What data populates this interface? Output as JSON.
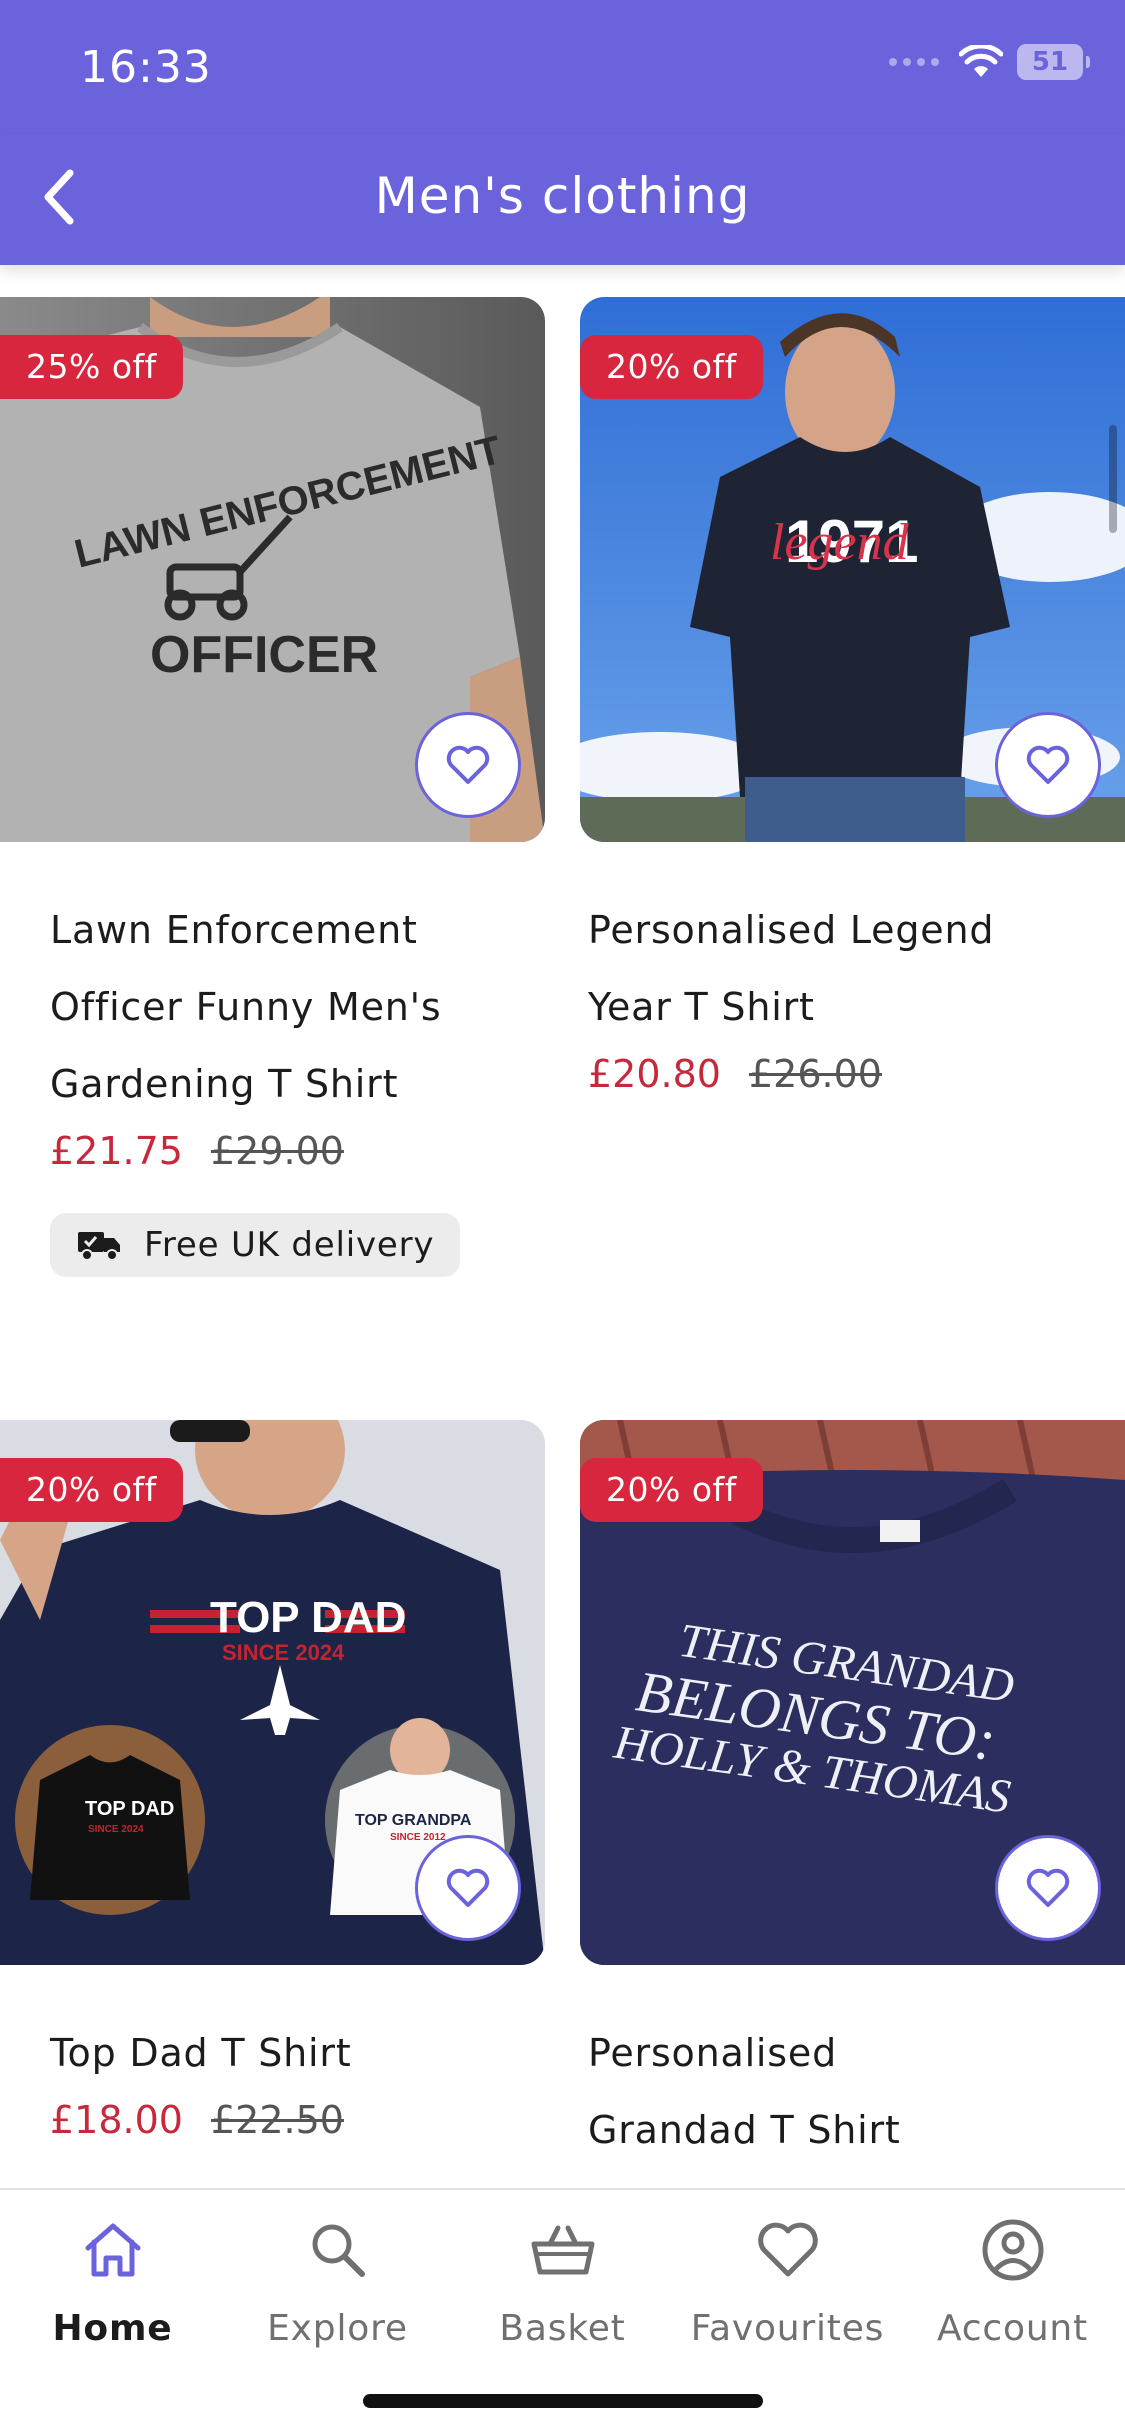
{
  "status": {
    "time": "16:33",
    "battery": "51"
  },
  "header": {
    "title": "Men's clothing"
  },
  "products": [
    {
      "title": "Lawn Enforcement Officer Funny Men's Gardening T Shirt",
      "badge": "25% off",
      "price": "£21.75",
      "was_price": "£29.00",
      "delivery": "Free UK delivery",
      "shirt_print": [
        "LAWN ENFORCEMENT",
        "OFFICER"
      ]
    },
    {
      "title": "Personalised Legend Year T Shirt",
      "badge": "20% off",
      "price": "£20.80",
      "was_price": "£26.00",
      "shirt_print": [
        "1971",
        "legend"
      ]
    },
    {
      "title": "Top Dad T Shirt",
      "badge": "20% off",
      "price": "£18.00",
      "was_price": "£22.50",
      "shirt_print": [
        "TOP DAD",
        "SINCE 2024",
        "TOP DAD",
        "SINCE 2024",
        "TOP GRANDPA",
        "SINCE 2012"
      ]
    },
    {
      "title": "Personalised Grandad T Shirt",
      "badge": "20% off",
      "shirt_print": [
        "THIS GRANDAD",
        "BELONGS TO:",
        "HOLLY & THOMAS"
      ]
    }
  ],
  "tabs": [
    {
      "label": "Home",
      "icon": "home-icon",
      "active": true
    },
    {
      "label": "Explore",
      "icon": "search-icon"
    },
    {
      "label": "Basket",
      "icon": "basket-icon"
    },
    {
      "label": "Favourites",
      "icon": "heart-icon"
    },
    {
      "label": "Account",
      "icon": "account-icon"
    }
  ],
  "colors": {
    "brand": "#6b63dc",
    "sale_red": "#d7263d",
    "price_red": "#c6283c"
  }
}
